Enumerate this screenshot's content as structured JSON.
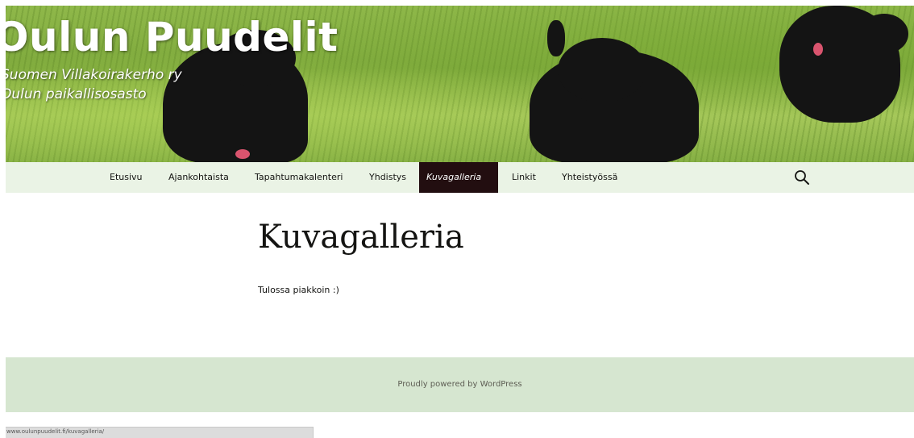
{
  "header": {
    "site_title": "Oulun Puudelit",
    "site_description_line1": "Suomen Villakoirakerho ry",
    "site_description_line2": "Oulun paikallisosasto"
  },
  "nav": {
    "items": [
      {
        "label": "Etusivu"
      },
      {
        "label": "Ajankohtaista"
      },
      {
        "label": "Tapahtumakalenteri"
      },
      {
        "label": "Yhdistys"
      },
      {
        "label": "Kuvagalleria",
        "active": true
      },
      {
        "label": "Linkit"
      },
      {
        "label": "Yhteistyössä"
      }
    ],
    "search_icon": "search-icon"
  },
  "main": {
    "page_title": "Kuvagalleria",
    "body_text": "Tulossa piakkoin :)"
  },
  "footer": {
    "credit": "Proudly powered by WordPress"
  },
  "status_bar": {
    "url": "www.oulunpuudelit.fi/kuvagalleria/"
  },
  "colors": {
    "nav_background": "#eaf3e5",
    "nav_active": "#220e10",
    "footer_background": "#d6e6d0"
  }
}
